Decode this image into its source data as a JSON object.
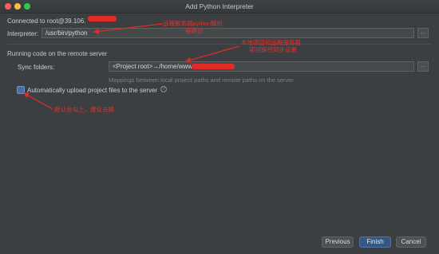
{
  "window": {
    "title": "Add Python Interpreter"
  },
  "connection": {
    "text": "Connected to root@39.106."
  },
  "interpreter": {
    "label": "Interpreter:",
    "value": "/usr/bin/python"
  },
  "remote": {
    "section_title": "Running code on the remote server"
  },
  "sync": {
    "label": "Sync folders:",
    "value": "<Project root>→/home/www/",
    "hint": "Mappings between local project paths and remote paths on the server"
  },
  "upload": {
    "label": "Automatically upload project files to the server",
    "checked": true,
    "help_icon": "question-circle-icon"
  },
  "annotations": {
    "interpreter_note": [
      "远程服务器python解析",
      "器路径"
    ],
    "sync_note": [
      "本地项目和远程服务器",
      "项目路径同步设置"
    ],
    "upload_note": "默认会勾上，建议去掉"
  },
  "buttons": {
    "previous": "Previous",
    "finish": "Finish",
    "cancel": "Cancel"
  },
  "colors": {
    "accent": "#365880",
    "annotation": "#e22b27",
    "background": "#3b3f41"
  }
}
